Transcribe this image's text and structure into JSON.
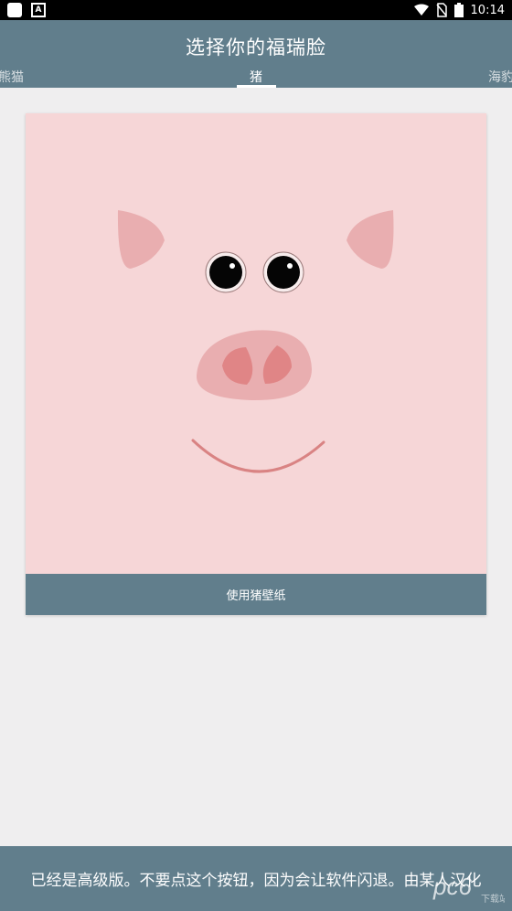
{
  "status_bar": {
    "time": "10:14",
    "left_icons": [
      "notification-icon",
      "a-icon"
    ],
    "right_icons": [
      "wifi-icon",
      "no-sim-icon",
      "battery-icon"
    ]
  },
  "header": {
    "title": "选择你的福瑞脸",
    "tabs": [
      {
        "label": "熊猫",
        "selected": false
      },
      {
        "label": "猪",
        "selected": true
      },
      {
        "label": "海豹",
        "selected": false
      }
    ]
  },
  "card": {
    "face": "pig-face",
    "button_label": "使用猪壁纸"
  },
  "bottom_bar": {
    "text": "已经是高级版。不要点这个按钮，因为会让软件闪退。由某人汉化"
  },
  "watermark": {
    "text": "pc6",
    "subtext": "下载站"
  },
  "colors": {
    "header": "#617e8c",
    "background": "#efeeef",
    "card": "#f6d6d7",
    "ear": "#e9aeb0",
    "snout": "#e9aeb0",
    "nostril": "#e08586",
    "mouth": "#d98383"
  }
}
